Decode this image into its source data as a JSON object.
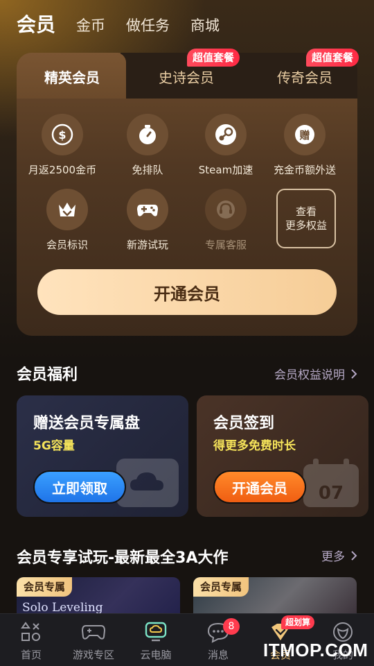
{
  "top_nav": {
    "active": "会员",
    "tabs": [
      "金币",
      "做任务",
      "商城"
    ]
  },
  "membership": {
    "tabs": [
      {
        "label": "精英会员",
        "badge": ""
      },
      {
        "label": "史诗会员",
        "badge": "超值套餐"
      },
      {
        "label": "传奇会员",
        "badge": "超值套餐"
      }
    ],
    "benefits": [
      {
        "label": "月返2500金币",
        "icon": "coin-icon"
      },
      {
        "label": "免排队",
        "icon": "stopwatch-icon"
      },
      {
        "label": "Steam加速",
        "icon": "steam-icon"
      },
      {
        "label": "充金币额外送",
        "icon": "gift-coin-icon"
      },
      {
        "label": "会员标识",
        "icon": "crown-icon"
      },
      {
        "label": "新游试玩",
        "icon": "gamepad-icon"
      },
      {
        "label": "专属客服",
        "icon": "headset-icon"
      }
    ],
    "more_benefits": [
      "查看",
      "更多权益"
    ],
    "open_button": "开通会员"
  },
  "welfare": {
    "title": "会员福利",
    "link": "会员权益说明",
    "cards": [
      {
        "title": "赠送会员专属盘",
        "subtitle": "5G容量",
        "button": "立即领取"
      },
      {
        "title": "会员签到",
        "subtitle": "得更多免费时长",
        "button": "开通会员"
      }
    ]
  },
  "trial": {
    "title": "会员专享试玩-最新最全3A大作",
    "link": "更多",
    "games": [
      {
        "tag": "会员专属",
        "name": "Solo Leveling"
      },
      {
        "tag": "会员专属",
        "name": ""
      }
    ]
  },
  "bottom_nav": {
    "items": [
      {
        "label": "首页",
        "icon": "home-shapes-icon"
      },
      {
        "label": "游戏专区",
        "icon": "gamepad-icon"
      },
      {
        "label": "云电脑",
        "icon": "cloud-pc-icon"
      },
      {
        "label": "消息",
        "icon": "chat-icon",
        "count": "8"
      },
      {
        "label": "会员",
        "icon": "member-diamond-icon",
        "badge": "超划算"
      },
      {
        "label": "我的",
        "icon": "profile-icon"
      }
    ]
  },
  "watermark": "ITMOP.COM",
  "colors": {
    "accent_gold": "#f2c77c",
    "badge_red": "#ff2a44",
    "button_blue": "#1f74e8",
    "button_orange": "#f05e12",
    "highlight_yellow": "#f5e35a"
  }
}
